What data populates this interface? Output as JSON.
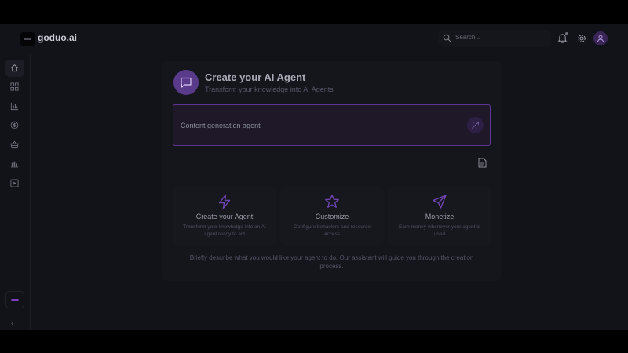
{
  "header": {
    "brand": "goduo.ai",
    "search_placeholder": "Search..."
  },
  "sidebar": {
    "items": [
      {
        "icon": "home-icon",
        "active": true
      },
      {
        "icon": "dashboard-icon"
      },
      {
        "icon": "bar-chart-icon"
      },
      {
        "icon": "dollar-circle-icon"
      },
      {
        "icon": "basket-icon"
      },
      {
        "icon": "analytics-icon"
      },
      {
        "icon": "play-square-icon"
      }
    ],
    "collapse_label": "‹"
  },
  "create": {
    "title": "Create your AI Agent",
    "subtitle": "Transform your knowledge into AI Agents",
    "input_value": "Content generation agent",
    "accent": "#7c3fbf"
  },
  "features": [
    {
      "icon": "lightning-icon",
      "title": "Create your Agent",
      "desc": "Transform your knowledge into an AI agent ready to act"
    },
    {
      "icon": "star-icon",
      "title": "Customize",
      "desc": "Configure behaviors and resource access"
    },
    {
      "icon": "send-icon",
      "title": "Monetize",
      "desc": "Earn money whenever your agent is used"
    }
  ],
  "footnote": "Briefly describe what you would like your agent to do. Our assistant will guide you through the creation process."
}
